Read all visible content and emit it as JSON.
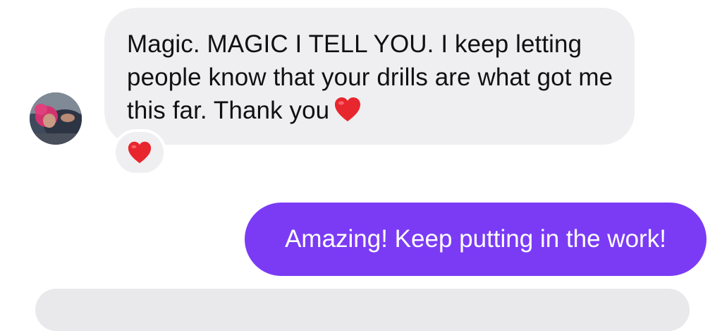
{
  "conversation": {
    "incoming_message": {
      "text": "Magic. MAGIC I TELL YOU. I keep letting people know that your drills are what got me this far. Thank you",
      "inline_emoji": "red-heart",
      "reaction": "red-heart"
    },
    "outgoing_message": {
      "text": "Amazing! Keep putting in the work!"
    }
  },
  "colors": {
    "incoming_bubble": "#efeff1",
    "outgoing_bubble": "#7b3bf5",
    "outgoing_text": "#ffffff",
    "incoming_text": "#111111",
    "heart": "#e8262e"
  }
}
